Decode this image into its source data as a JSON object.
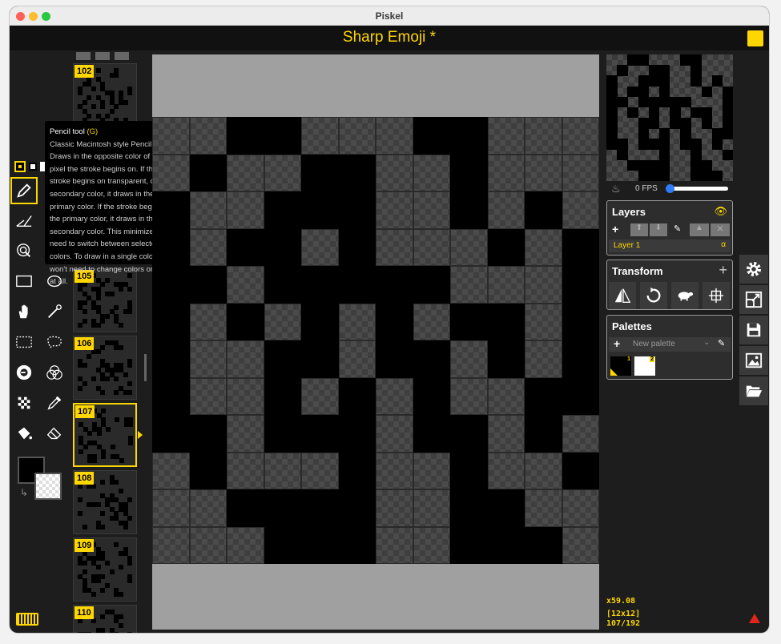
{
  "window": {
    "title": "Piskel"
  },
  "app": {
    "title": "Sharp Emoji *",
    "accent": "#ffd700"
  },
  "tooltip": {
    "title": "Pencil tool",
    "shortcut": "(G)",
    "body": "Classic Macintosh style Pencil. Draws in the opposite color of the pixel the stroke begins on. If the stroke begins on transparent, or the secondary color, it draws in the primary color. If the stroke begins on the primary color, it draws in the secondary color. This minimizes the need to switch between selected colors. To draw in a single color you won't need to change colors or tools at all."
  },
  "tools": [
    {
      "name": "pencil-tool",
      "icon": "pencil-icon",
      "selected": true
    },
    {
      "name": "vertical-mirror-tool",
      "icon": "mirror-pen-icon"
    },
    {
      "name": "lasso-select-tool",
      "icon": "lasso-icon"
    },
    {
      "name": "stroke-tool",
      "icon": "stroke-icon"
    },
    {
      "name": "rectangle-tool",
      "icon": "rectangle-icon"
    },
    {
      "name": "circle-tool",
      "icon": "circle-icon"
    },
    {
      "name": "move-tool",
      "icon": "hand-icon"
    },
    {
      "name": "shape-select-tool",
      "icon": "wand-icon"
    },
    {
      "name": "rect-select-tool",
      "icon": "dashed-rect-icon"
    },
    {
      "name": "lasso-tool",
      "icon": "dashed-lasso-icon"
    },
    {
      "name": "lighten-tool",
      "icon": "lighten-icon"
    },
    {
      "name": "dither-tool",
      "icon": "dither-icon"
    },
    {
      "name": "checker-tool",
      "icon": "checker-icon"
    },
    {
      "name": "eyedropper-tool",
      "icon": "eyedropper-icon"
    },
    {
      "name": "paint-bucket-tool",
      "icon": "bucket-icon"
    },
    {
      "name": "eraser-tool",
      "icon": "eraser-icon"
    }
  ],
  "frames": {
    "items": [
      {
        "num": "102",
        "selected": false
      },
      {
        "num": "105",
        "selected": false
      },
      {
        "num": "106",
        "selected": false
      },
      {
        "num": "107",
        "selected": true
      },
      {
        "num": "108",
        "selected": false
      },
      {
        "num": "109",
        "selected": false
      },
      {
        "num": "110",
        "selected": false
      }
    ]
  },
  "preview": {
    "fps_label": "0 FPS",
    "fps_value": 0
  },
  "layers": {
    "title": "Layers",
    "items": [
      {
        "label": "Layer 1",
        "alpha": "α"
      }
    ]
  },
  "transform": {
    "title": "Transform"
  },
  "palettes": {
    "title": "Palettes",
    "selected": "New palette",
    "swatch1": "1",
    "swatch2": "2"
  },
  "status": {
    "zoom": "x59.08",
    "size": "[12x12]",
    "frame": "107/192"
  },
  "sprite": {
    "rows": [
      "001100011000",
      "010011001000",
      "100111001010",
      "101101000101",
      "110111110001",
      "101010101101",
      "100110110101",
      "100101010011",
      "110111011010",
      "010001001001",
      "001111001100",
      "000111001110"
    ]
  }
}
